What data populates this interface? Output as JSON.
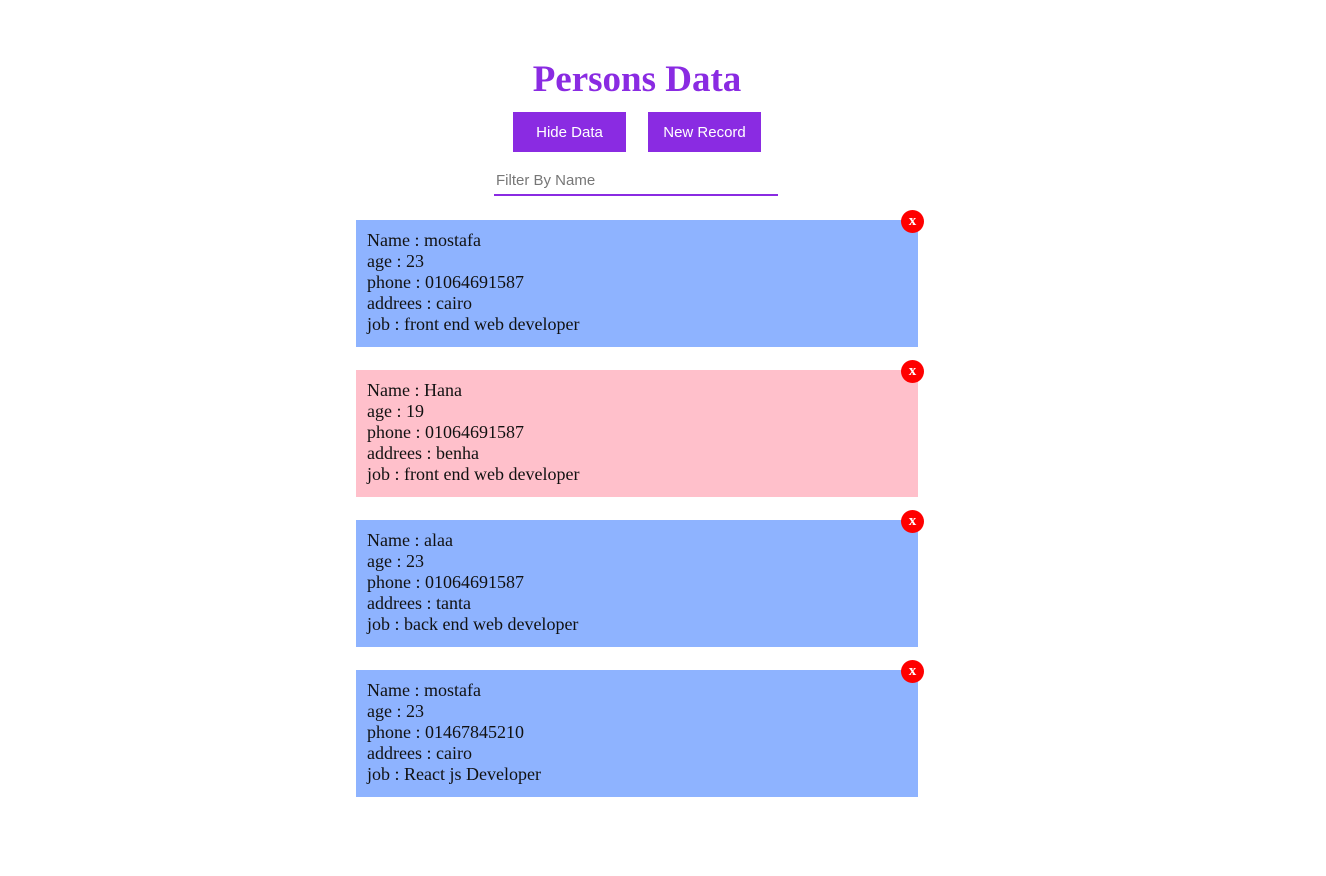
{
  "title": "Persons Data",
  "buttons": {
    "hide_label": "Hide Data",
    "new_label": "New Record"
  },
  "filter": {
    "placeholder": "Filter By Name",
    "value": ""
  },
  "colors": {
    "accent": "#8a2be2",
    "card_blue": "#8eb3ff",
    "card_pink": "#ffc0cb",
    "close_red": "#ff0000"
  },
  "close_label": "x",
  "persons": [
    {
      "color": "#8eb3ff",
      "name": "Name : mostafa",
      "age": "age : 23",
      "phone": "phone : 01064691587",
      "address": "addrees : cairo",
      "job": "job : front end web developer"
    },
    {
      "color": "#ffc0cb",
      "name": "Name : Hana",
      "age": "age : 19",
      "phone": "phone : 01064691587",
      "address": "addrees : benha",
      "job": "job : front end web developer"
    },
    {
      "color": "#8eb3ff",
      "name": "Name : alaa",
      "age": "age : 23",
      "phone": "phone : 01064691587",
      "address": "addrees : tanta",
      "job": "job : back end web developer"
    },
    {
      "color": "#8eb3ff",
      "name": "Name : mostafa",
      "age": "age : 23",
      "phone": "phone : 01467845210",
      "address": "addrees : cairo",
      "job": "job : React js Developer"
    }
  ]
}
